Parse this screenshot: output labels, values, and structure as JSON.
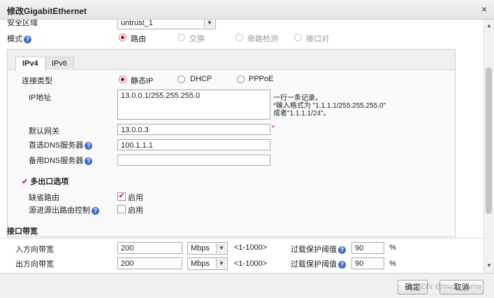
{
  "dialog": {
    "title": "修改GigabitEthernet",
    "close": "×"
  },
  "top": {
    "zone_label": "安全区域",
    "zone_value": "untrust_1",
    "mode_label": "模式",
    "mode_options": [
      "路由",
      "交换",
      "旁路检测",
      "接口对"
    ]
  },
  "tabs": [
    "IPv4",
    "IPv6"
  ],
  "ipv4": {
    "conn_type_label": "连接类型",
    "conn_options": [
      "静态IP",
      "DHCP",
      "PPPoE"
    ],
    "ip_label": "IP地址",
    "ip_value": "13.0.0.1/255.255.255.0",
    "ip_hint_line1": "一行一条记录，",
    "ip_hint_line2": "输入格式为 \"1.1.1.1/255.255.255.0\"",
    "ip_hint_line3": "或者\"1.1.1.1/24\"。",
    "gateway_label": "默认网关",
    "gateway_value": "13.0.0.3",
    "dns1_label": "首选DNS服务器",
    "dns1_value": "100.1.1.1",
    "dns2_label": "备用DNS服务器",
    "dns2_value": "",
    "multi_exit_label": "多出口选项",
    "default_route_label": "缺省路由",
    "default_route_enable": "启用",
    "src_route_label": "源进源出路由控制",
    "src_route_enable": "启用"
  },
  "bandwidth": {
    "section_title": "接口带宽",
    "in_label": "入方向带宽",
    "in_value": "200",
    "in_unit": "Mbps",
    "in_range": "<1-1000>",
    "in_overload_label": "过载保护阈值",
    "in_overload_value": "90",
    "out_label": "出方向带宽",
    "out_value": "200",
    "out_unit": "Mbps",
    "out_range": "<1-1000>",
    "out_overload_label": "过载保护阈值",
    "out_overload_value": "90",
    "percent": "%"
  },
  "footer": {
    "ok": "确定",
    "cancel": "取消"
  },
  "watermark": "CSDN @twcc_game",
  "icons": {
    "help": "?",
    "check": "✔",
    "arrow_down": "▼",
    "scroll_up": "▲",
    "scroll_down": "▼"
  }
}
